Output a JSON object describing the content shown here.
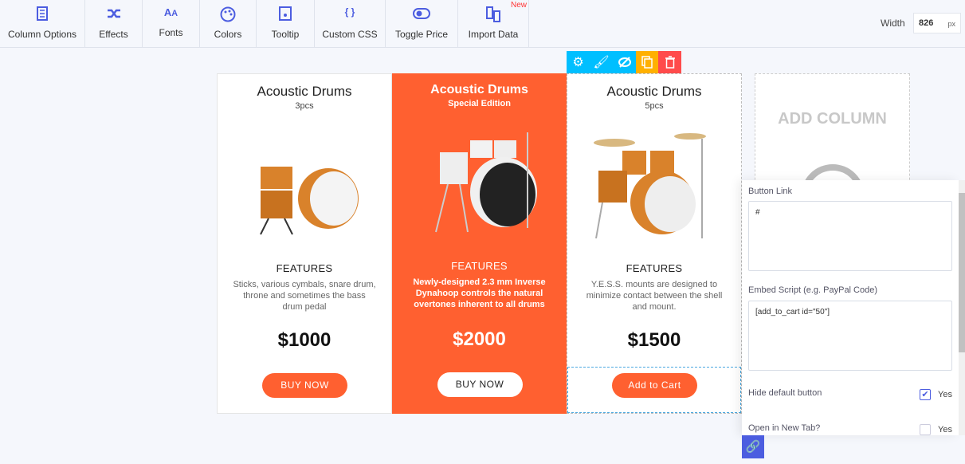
{
  "toolbar": {
    "items": [
      {
        "label": "Column Options",
        "icon": "column-options-icon"
      },
      {
        "label": "Effects",
        "icon": "shuffle-icon"
      },
      {
        "label": "Fonts",
        "icon": "font-size-icon"
      },
      {
        "label": "Colors",
        "icon": "palette-icon"
      },
      {
        "label": "Tooltip",
        "icon": "tooltip-icon"
      },
      {
        "label": "Custom CSS",
        "icon": "braces-icon"
      },
      {
        "label": "Toggle Price",
        "icon": "toggle-icon"
      },
      {
        "label": "Import Data",
        "icon": "import-icon",
        "badge": "New"
      }
    ],
    "width_label": "Width",
    "width_value": "826",
    "width_unit": "px"
  },
  "columns": [
    {
      "title": "Acoustic Drums",
      "subtitle": "3pcs",
      "features_title": "FEATURES",
      "features": "Sticks, various cymbals, snare drum, throne and sometimes the bass drum pedal",
      "price": "$1000",
      "button": "BUY NOW"
    },
    {
      "title": "Acoustic Drums",
      "subtitle": "Special Edition",
      "features_title": "FEATURES",
      "features": "Newly-designed 2.3 mm Inverse Dynahoop controls the natural overtones inherent to all drums",
      "price": "$2000",
      "button": "BUY NOW"
    },
    {
      "title": "Acoustic Drums",
      "subtitle": "5pcs",
      "features_title": "FEATURES",
      "features": "Y.E.S.S. mounts are designed to minimize contact between the shell and mount.",
      "price": "$1500",
      "button": "Add to Cart"
    }
  ],
  "add_column": "ADD COLUMN",
  "colors": {
    "accent": "#ff6030",
    "primary": "#4c5de0",
    "tool_blue": "#00bfff",
    "tool_orange": "#ffb000",
    "tool_red": "#ff4b4b"
  },
  "panel": {
    "button_link_label": "Button Link",
    "button_link_value": "#",
    "embed_label": "Embed Script (e.g. PayPal Code)",
    "embed_value": "[add_to_cart id=\"50\"]",
    "hide_default_label": "Hide default button",
    "hide_default_checked": true,
    "hide_default_yes": "Yes",
    "new_tab_label": "Open in New Tab?",
    "new_tab_checked": false,
    "new_tab_yes": "Yes"
  }
}
